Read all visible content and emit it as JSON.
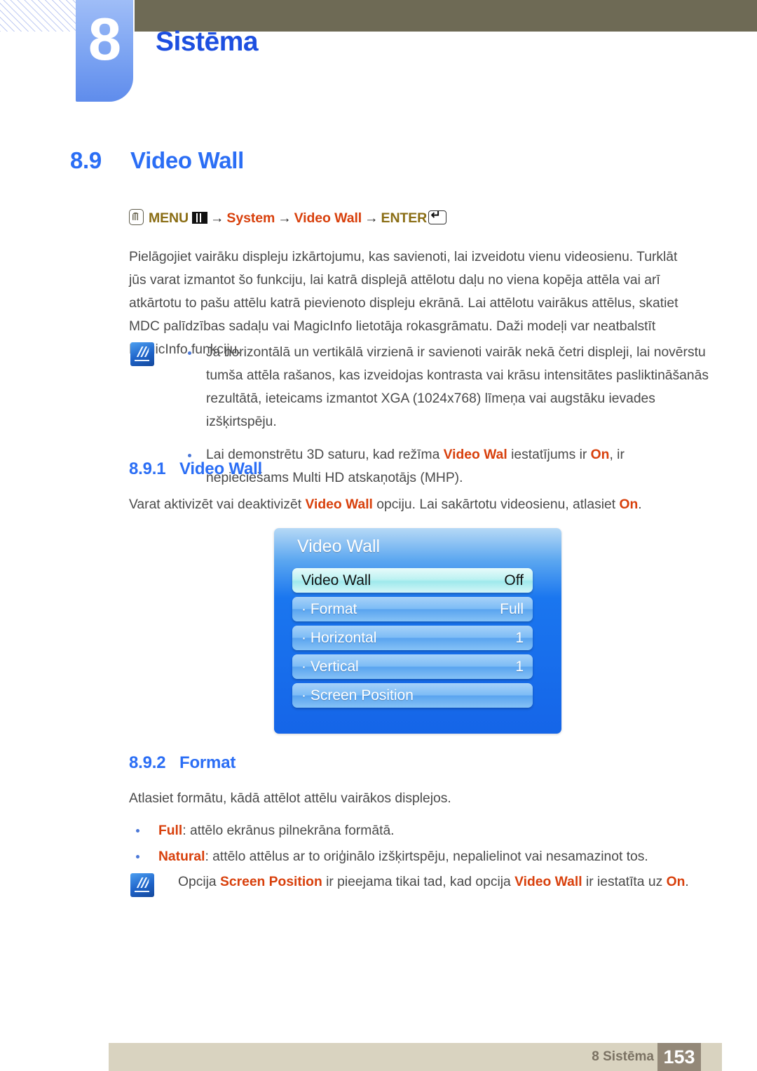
{
  "header": {
    "chapter_number": "8",
    "chapter_title": "Sistēma",
    "bar_color": "#6e6a55",
    "tab_color": "#7ba3f2",
    "title_color": "#1d4fe0"
  },
  "section": {
    "number": "8.9",
    "title": "Video Wall"
  },
  "menu_path": {
    "touch_icon": "touch-button-icon",
    "menu_label": "MENU",
    "menu_icon": "menu-grid-icon",
    "arrow": "→",
    "item1": "System",
    "item2": "Video Wall",
    "enter_label": "ENTER",
    "enter_icon": "enter-key-icon",
    "gold_color": "#8a6d14",
    "red_color": "#d8400c"
  },
  "intro_paragraph": "Pielāgojiet vairāku displeju izkārtojumu, kas savienoti, lai izveidotu vienu videosienu. Turklāt jūs varat izmantot šo funkciju, lai katrā displejā attēlotu daļu no viena kopēja attēla vai arī atkārtotu to pašu attēlu katrā pievienoto displeju ekrānā. Lai attēlotu vairākus attēlus, skatiet MDC palīdzības sadaļu vai MagicInfo lietotāja rokasgrāmatu. Daži modeļi var neatbalstīt MagicInfo funkciju.",
  "note_top": {
    "icon": "note-pencil-icon",
    "items": [
      {
        "text_before": "Ja horizontālā un vertikālā virzienā ir savienoti vairāk nekā četri displeji, lai novērstu tumša attēla rašanos, kas izveidojas kontrasta vai krāsu intensitātes pasliktināšanās rezultātā, ieteicams izmantot XGA (1024x768) līmeņa vai augstāku ievades izšķirtspēju."
      },
      {
        "seg1": "Lai demonstrētu 3D saturu, kad režīma ",
        "hl1": "Video Wal",
        "seg2": " iestatījums ir ",
        "hl2": "On",
        "seg3": ", ir nepieciešams Multi HD atskaņotājs (MHP)."
      }
    ]
  },
  "subsection_1": {
    "number": "8.9.1",
    "title": "Video Wall",
    "paragraph": {
      "seg1": "Varat aktivizēt vai deaktivizēt ",
      "hl1": "Video Wall",
      "seg2": " opciju. Lai sakārtotu videosienu, atlasiet ",
      "hl2": "On",
      "seg3": "."
    }
  },
  "osd": {
    "title": "Video Wall",
    "rows": [
      {
        "label": "Video Wall",
        "value": "Off",
        "selected": true
      },
      {
        "label": "· Format",
        "value": "Full",
        "selected": false
      },
      {
        "label": "· Horizontal",
        "value": "1",
        "selected": false
      },
      {
        "label": "· Vertical",
        "value": "1",
        "selected": false
      },
      {
        "label": "· Screen Position",
        "value": "",
        "selected": false
      }
    ],
    "panel_color": "#1a76ef",
    "selected_color": "#bdf2f2"
  },
  "subsection_2": {
    "number": "8.9.2",
    "title": "Format",
    "paragraph": "Atlasiet formātu, kādā attēlot attēlu vairākos displejos.",
    "bullets": [
      {
        "hl": "Full",
        "text": ": attēlo ekrānus pilnekrāna formātā."
      },
      {
        "hl": "Natural",
        "text": ": attēlo attēlus ar to oriģinālo izšķirtspēju, nepalielinot vai nesamazinot tos."
      }
    ]
  },
  "note_bottom": {
    "icon": "note-pencil-icon",
    "seg1": "Opcija ",
    "hl1": "Screen Position",
    "seg2": " ir pieejama tikai tad, kad opcija ",
    "hl2": "Video Wall",
    "seg3": " ir iestatīta uz ",
    "hl3": "On",
    "seg4": "."
  },
  "footer": {
    "label": "8 Sistēma",
    "page": "153",
    "bar_color": "#d9d3c0",
    "page_box_color": "#938878"
  }
}
